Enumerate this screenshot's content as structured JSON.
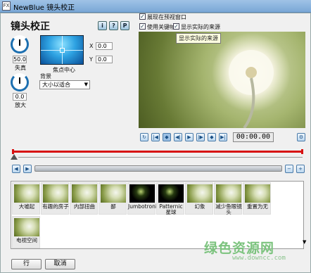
{
  "window": {
    "title": "NewBlue 镜头校正",
    "icon": "fx-app-icon"
  },
  "heading": "镜头校正",
  "help_buttons": [
    {
      "label": "i"
    },
    {
      "label": "?"
    },
    {
      "label": "P"
    }
  ],
  "controls": {
    "distortion": {
      "value": "50.0",
      "label": "失真"
    },
    "zoom": {
      "value": "0.0",
      "label": "放大"
    },
    "focal_center": {
      "label": "焦点中心",
      "x_label": "X",
      "x_value": "0.0",
      "y_label": "Y",
      "y_value": "0.0"
    },
    "background": {
      "label": "背景",
      "selected": "大小以适合"
    }
  },
  "options": {
    "show_in_preview": {
      "label": "展现在预视窗口",
      "checked": true
    },
    "use_keyframes": {
      "label": "使用关键帧",
      "checked": true
    },
    "show_actual_source": {
      "label": "显示实际的来源",
      "checked": true
    }
  },
  "tooltip": "显示实际的来源",
  "transport": {
    "timecode": "00:00.00",
    "buttons": [
      "loop-icon",
      "go-start-icon",
      "prev-keyframe-icon",
      "step-back-icon",
      "play-icon",
      "step-forward-icon",
      "next-keyframe-icon",
      "go-end-icon",
      "settings-icon"
    ]
  },
  "effects": [
    {
      "label": "大嘘起",
      "thumb": "light"
    },
    {
      "label": "有趣的房子",
      "thumb": "light"
    },
    {
      "label": "内部扭曲",
      "thumb": "light"
    },
    {
      "label": "鄙",
      "thumb": "light"
    },
    {
      "label": "Jumbotronic",
      "thumb": "dark"
    },
    {
      "label": "Patternic 星球",
      "thumb": "dark"
    },
    {
      "label": "幻象",
      "thumb": "light"
    },
    {
      "label": "减少鱼眼镜头",
      "thumb": "light"
    },
    {
      "label": "重置为无",
      "thumb": "light"
    },
    {
      "label": "电视空间",
      "thumb": "light"
    }
  ],
  "buttons": {
    "ok": "行",
    "cancel": "取消"
  },
  "watermark": {
    "text": "绿色资源网",
    "url": "www.downcc.com"
  },
  "colors": {
    "timeline": "#d71010",
    "accent": "#1c6fb0"
  }
}
